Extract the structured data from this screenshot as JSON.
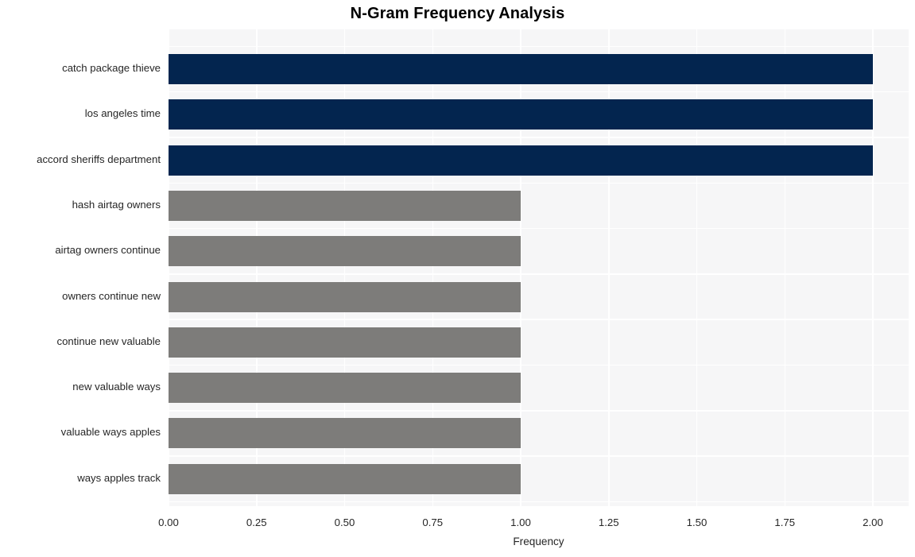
{
  "chart_data": {
    "type": "bar",
    "orientation": "horizontal",
    "title": "N-Gram Frequency Analysis",
    "xlabel": "Frequency",
    "ylabel": "",
    "categories": [
      "catch package thieve",
      "los angeles time",
      "accord sheriffs department",
      "hash airtag owners",
      "airtag owners continue",
      "owners continue new",
      "continue new valuable",
      "new valuable ways",
      "valuable ways apples",
      "ways apples track"
    ],
    "values": [
      2,
      2,
      2,
      1,
      1,
      1,
      1,
      1,
      1,
      1
    ],
    "bar_colors": [
      "#03254f",
      "#03254f",
      "#03254f",
      "#7d7c7a",
      "#7d7c7a",
      "#7d7c7a",
      "#7d7c7a",
      "#7d7c7a",
      "#7d7c7a",
      "#7d7c7a"
    ],
    "xlim": [
      0,
      2
    ],
    "xticks": [
      0,
      0.25,
      0.5,
      0.75,
      1,
      1.25,
      1.5,
      1.75,
      2
    ],
    "xtick_labels": [
      "0.00",
      "0.25",
      "0.50",
      "0.75",
      "1.00",
      "1.25",
      "1.50",
      "1.75",
      "2.00"
    ],
    "grid": true,
    "grid_color": "#ffffff",
    "plot_background": "#f6f6f7",
    "figure_background": "#ffffff",
    "legend": null,
    "highlight_color": "#03254f",
    "secondary_color": "#7d7c7a"
  }
}
